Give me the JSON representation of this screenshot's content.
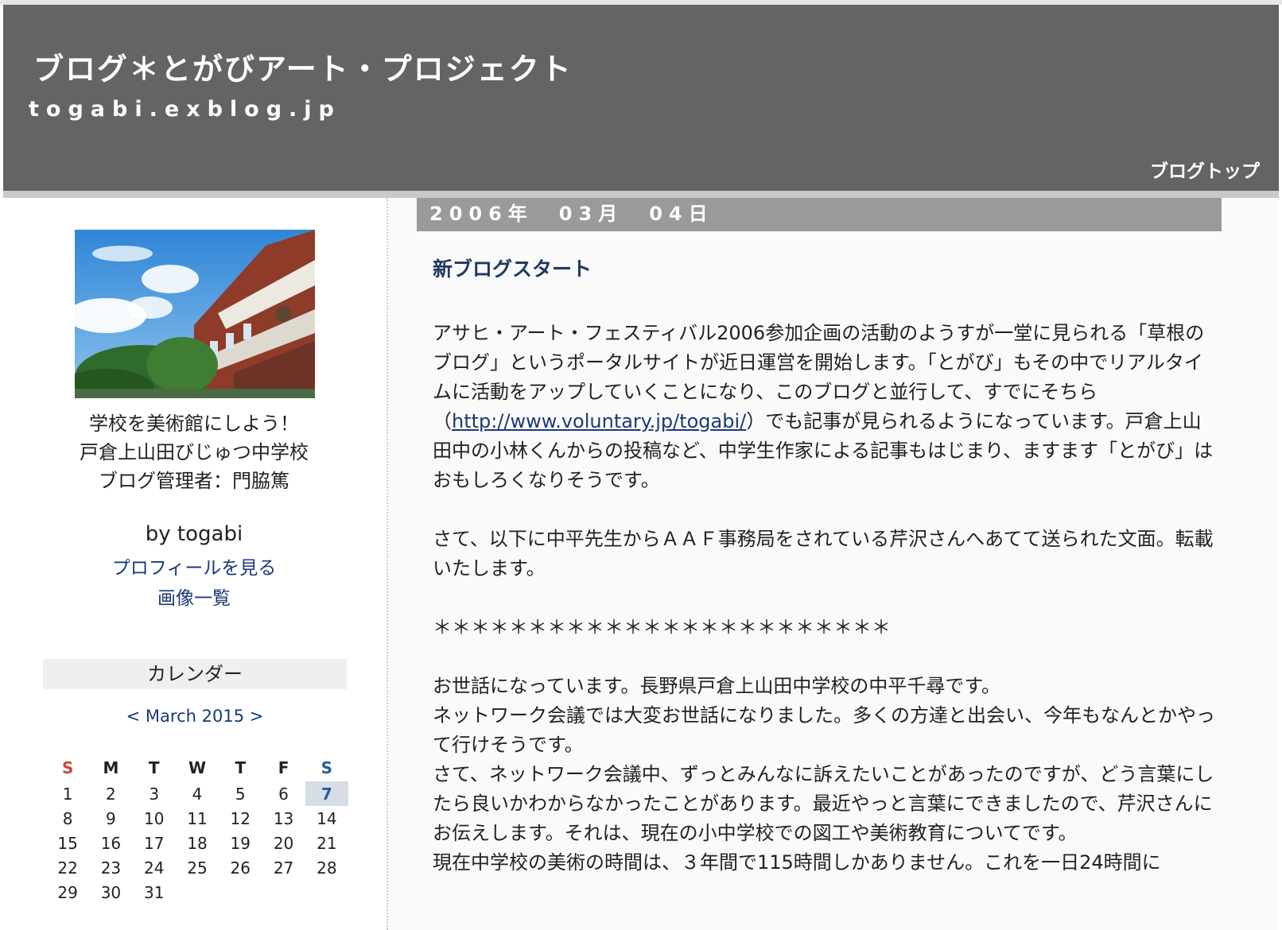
{
  "header": {
    "title": "ブログ＊とがびアート・プロジェクト",
    "url": "togabi.exblog.jp",
    "blog_top_link": "ブログトップ"
  },
  "sidebar": {
    "profile_description": "学校を美術館にしよう！　　　　　戸倉上山田びじゅつ中学校　　　ブログ管理者：門脇篤",
    "byline": "by togabi",
    "profile_link": "プロフィールを見る",
    "images_link": "画像一覧",
    "calendar": {
      "heading": "カレンダー",
      "prev": "<",
      "month_label": "March 2015",
      "next": ">",
      "weekdays": [
        "S",
        "M",
        "T",
        "W",
        "T",
        "F",
        "S"
      ],
      "weeks": [
        [
          "1",
          "2",
          "3",
          "4",
          "5",
          "6",
          "7"
        ],
        [
          "8",
          "9",
          "10",
          "11",
          "12",
          "13",
          "14"
        ],
        [
          "15",
          "16",
          "17",
          "18",
          "19",
          "20",
          "21"
        ],
        [
          "22",
          "23",
          "24",
          "25",
          "26",
          "27",
          "28"
        ],
        [
          "29",
          "30",
          "31",
          "",
          "",
          "",
          ""
        ]
      ],
      "today": "7"
    }
  },
  "post": {
    "date": "2006年　03月　04日",
    "title": "新ブログスタート",
    "p1_before_link": "アサヒ・アート・フェスティバル2006参加企画の活動のようすが一堂に見られる「草根のブログ」というポータルサイトが近日運営を開始します。「とがび」もその中でリアルタイムに活動をアップしていくことになり、このブログと並行して、すでにそちら（",
    "p1_link": "http://www.voluntary.jp/togabi/",
    "p1_after_link": "）でも記事が見られるようになっています。戸倉上山田中の小林くんからの投稿など、中学生作家による記事もはじまり、ますます「とがび」はおもしろくなりそうです。",
    "p2": "さて、以下に中平先生からＡＡＦ事務局をされている芹沢さんへあてて送られた文面。転載いたします。",
    "separator": "＊＊＊＊＊＊＊＊＊＊＊＊＊＊＊＊＊＊＊＊＊＊＊＊",
    "p3_line1": "お世話になっています。長野県戸倉上山田中学校の中平千尋です。",
    "p3_line2": "ネットワーク会議では大変お世話になりました。多くの方達と出会い、今年もなんとかやって行けそうです。",
    "p3_line3": "さて、ネットワーク会議中、ずっとみんなに訴えたいことがあったのですが、どう言葉にしたら良いかわからなかったことがあります。最近やっと言葉にできましたので、芹沢さんにお伝えします。それは、現在の小中学校での図工や美術教育についてです。",
    "p3_line4": "現在中学校の美術の時間は、３年間で115時間しかありません。これを一日24時間に"
  }
}
